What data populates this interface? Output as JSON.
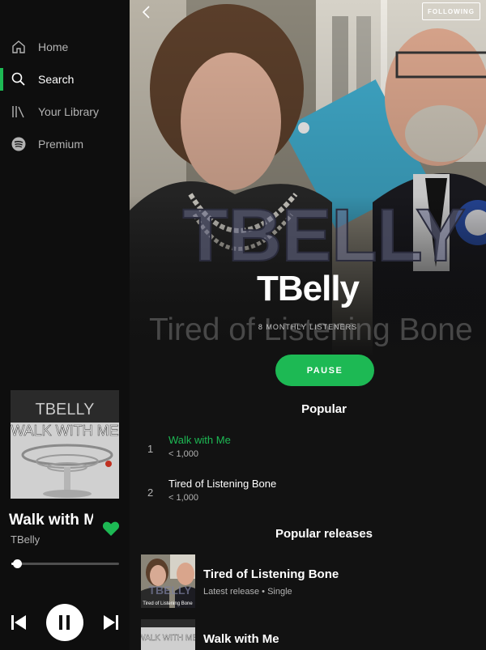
{
  "colors": {
    "accent": "#1db954",
    "background": "#121212",
    "sidebar": "#0e0e0e",
    "text_secondary": "#b3b3b3"
  },
  "sidebar": {
    "items": [
      {
        "label": "Home",
        "icon": "home-icon",
        "active": false
      },
      {
        "label": "Search",
        "icon": "search-icon",
        "active": true
      },
      {
        "label": "Your Library",
        "icon": "library-icon",
        "active": false
      },
      {
        "label": "Premium",
        "icon": "spotify-icon",
        "active": false
      }
    ]
  },
  "now_playing": {
    "art_text_top": "TBELLY",
    "art_text_main": "WALK WITH ME",
    "title": "Walk with Me",
    "artist": "TBelly",
    "liked": true,
    "progress": 0.05,
    "icons": {
      "prev": "skip-back-icon",
      "pause": "pause-icon",
      "next": "skip-forward-icon",
      "like": "heart-icon"
    }
  },
  "header": {
    "follow_label": "FOLLOWING",
    "artist_name": "TBelly",
    "logo_text": "TBELLY",
    "background_text": "Tired of Listening Bone",
    "listeners": "8 MONTHLY LISTENERS",
    "play_label": "PAUSE"
  },
  "popular": {
    "title": "Popular",
    "tracks": [
      {
        "num": "1",
        "name": "Walk with Me",
        "plays": "< 1,000",
        "playing": true
      },
      {
        "num": "2",
        "name": "Tired of Listening Bone",
        "plays": "< 1,000",
        "playing": false
      }
    ]
  },
  "popular_releases": {
    "title": "Popular releases",
    "items": [
      {
        "name": "Tired of Listening Bone",
        "subtitle": "Latest release • Single",
        "art_caption": "Tired of Listening Bone"
      },
      {
        "name": "Walk with Me",
        "subtitle": "",
        "art_caption": "WALK WITH ME"
      }
    ]
  }
}
